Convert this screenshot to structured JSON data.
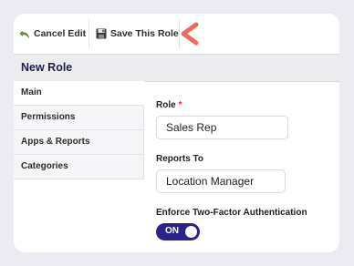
{
  "toolbar": {
    "cancel_label": "Cancel Edit",
    "save_label": "Save This Role"
  },
  "section": {
    "title": "New Role"
  },
  "sidebar": {
    "items": [
      {
        "label": "Main",
        "active": true
      },
      {
        "label": "Permissions",
        "active": false
      },
      {
        "label": "Apps & Reports",
        "active": false
      },
      {
        "label": "Categories",
        "active": false
      }
    ]
  },
  "form": {
    "role_label": "Role",
    "role_required_mark": "*",
    "role_value": "Sales Rep",
    "reports_to_label": "Reports To",
    "reports_to_value": "Location Manager",
    "two_factor_label": "Enforce Two-Factor Authentication",
    "two_factor_toggle": "ON"
  },
  "colors": {
    "accent": "#2a2488",
    "required": "#d83a3a",
    "pointer_arrow": "#f06a5a"
  }
}
